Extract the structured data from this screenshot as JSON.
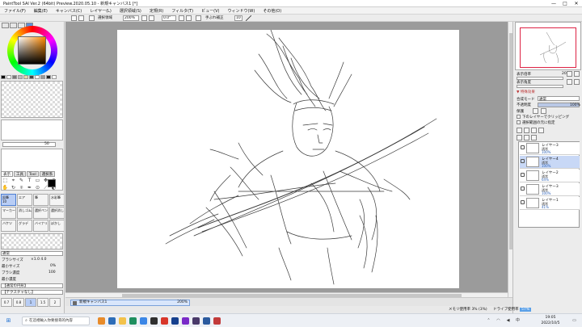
{
  "titlebar": {
    "title": "PaintTool SAI Ver.2 (64bit) Preview.2020.05.10 - 新規キャンバス1 [*]",
    "minimize": "—",
    "maximize": "□",
    "close": "✕"
  },
  "menu": [
    "ファイル(F)",
    "編集(E)",
    "キャンバス(C)",
    "レイヤー(L)",
    "選択領域(S)",
    "定規(R)",
    "フィルタ(T)",
    "ビュー(V)",
    "ウィンドウ(W)",
    "その他(O)"
  ],
  "toolbar": {
    "selection_label": "選択領域",
    "zoom_value": "200%",
    "rotate_value": "0.0°",
    "stabilizer_label": "手ぶれ補正",
    "stabilizer_value": "10"
  },
  "left_panel": {
    "opacity_value": "50",
    "tool_tabs": [
      "表示",
      "工具",
      "Tool",
      "選択系"
    ],
    "tools_glyphs": [
      "⬚",
      "⌖",
      "✎",
      "T",
      "▭",
      "✥",
      "⊕",
      "✋",
      "↻",
      "⌾",
      "✒",
      "⊙",
      "⟋",
      "◐"
    ],
    "brushes": [
      {
        "name": "鉛筆",
        "sub": "10"
      },
      {
        "name": "エア",
        "sub": ""
      },
      {
        "name": "筆",
        "sub": ""
      },
      {
        "name": "水彩筆",
        "sub": ""
      },
      {
        "name": "マーカー",
        "sub": ""
      },
      {
        "name": "消しゴム",
        "sub": ""
      },
      {
        "name": "選択ペン",
        "sub": ""
      },
      {
        "name": "選択消し",
        "sub": ""
      },
      {
        "name": "バケツ",
        "sub": ""
      },
      {
        "name": "グラデ",
        "sub": ""
      },
      {
        "name": "バイナリ",
        "sub": ""
      },
      {
        "name": "ぼかし",
        "sub": ""
      }
    ],
    "blend_mode": "通常",
    "brush_size_label": "ブラシサイズ",
    "brush_size_value": "×1.0   4.0",
    "min_size_label": "最小サイズ",
    "min_size_value": "0%",
    "density_label": "ブラシ濃度",
    "density_value": "100",
    "min_density_label": "最小濃度",
    "shape_label": "【通常の円形】",
    "texture_label": "【テクスチャなし】",
    "sizes": [
      "0.7",
      "0.8",
      "1",
      "1.5",
      "2"
    ]
  },
  "document_tab": {
    "name": "新規キャンバス1",
    "zoom": "200%"
  },
  "right_panel": {
    "zoom_label": "表示倍率",
    "zoom_value": "200%",
    "angle_label": "表示角度",
    "angle_value": "0°",
    "layer_props_label": "▼ 特殊効果",
    "blend_label": "合成モード",
    "blend_value": "通常",
    "opacity_label": "不透明度",
    "opacity_value": "100%",
    "protect_label": "保護",
    "clip_label": "下のレイヤーでクリッピング",
    "select_source_label": "選択範囲の元に指定",
    "layers": [
      {
        "name": "レイヤー3",
        "mode": "通常",
        "opacity": "100%"
      },
      {
        "name": "レイヤー4",
        "mode": "通常",
        "opacity": "100%"
      },
      {
        "name": "レイヤー2",
        "mode": "通常",
        "opacity": "64%"
      },
      {
        "name": "レイヤー3",
        "mode": "通常",
        "opacity": "100%"
      },
      {
        "name": "レイヤー1",
        "mode": "通常",
        "opacity": "41%"
      }
    ]
  },
  "status": {
    "memory_label": "メモリ使用率",
    "memory_value": "3% (3%)",
    "drive_label": "ドライブ使用率",
    "drive_value": "57%"
  },
  "taskbar": {
    "search_placeholder": "在這裡輸入你要搜尋的內容",
    "time": "19:05",
    "date": "2022/10/5"
  }
}
